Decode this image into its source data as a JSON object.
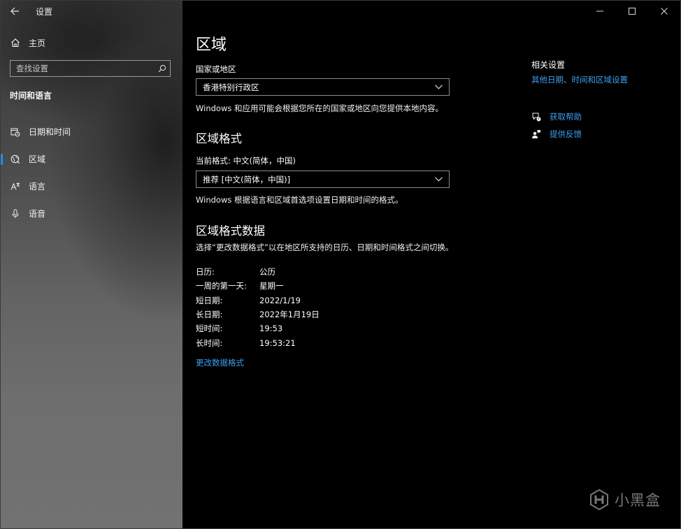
{
  "window": {
    "app_title": "设置",
    "controls": {
      "minimize": "minimize-icon",
      "maximize": "maximize-icon",
      "close": "close-icon"
    }
  },
  "sidebar": {
    "home_label": "主页",
    "search_placeholder": "查找设置",
    "section_title": "时间和语言",
    "items": [
      {
        "label": "日期和时间",
        "icon": "calendar-clock-icon",
        "active": false
      },
      {
        "label": "区域",
        "icon": "globe-region-icon",
        "active": true
      },
      {
        "label": "语言",
        "icon": "language-icon",
        "active": false
      },
      {
        "label": "语音",
        "icon": "microphone-icon",
        "active": false
      }
    ]
  },
  "main": {
    "title": "区域",
    "country": {
      "label": "国家或地区",
      "value": "香港特别行政区",
      "description": "Windows 和应用可能会根据您所在的国家或地区向您提供本地内容。"
    },
    "format": {
      "title": "区域格式",
      "label": "当前格式: 中文(简体，中国)",
      "value": "推荐 [中文(简体，中国)]",
      "description": "Windows 根据语言和区域首选项设置日期和时间的格式。"
    },
    "format_data": {
      "title": "区域格式数据",
      "description": "选择“更改数据格式”以在地区所支持的日历、日期和时间格式之间切换。",
      "rows": [
        {
          "key": "日历:",
          "value": "公历"
        },
        {
          "key": "一周的第一天:",
          "value": "星期一"
        },
        {
          "key": "短日期:",
          "value": "2022/1/19"
        },
        {
          "key": "长日期:",
          "value": "2022年1月19日"
        },
        {
          "key": "短时间:",
          "value": "19:53"
        },
        {
          "key": "长时间:",
          "value": "19:53:21"
        }
      ],
      "change_link": "更改数据格式"
    }
  },
  "related": {
    "title": "相关设置",
    "link": "其他日期、时间和区域设置",
    "help": "获取帮助",
    "feedback": "提供反馈"
  },
  "watermark": {
    "text": "小黑盒"
  },
  "colors": {
    "accent": "#2a8be0",
    "link": "#3d9ff0",
    "background": "#000000"
  }
}
